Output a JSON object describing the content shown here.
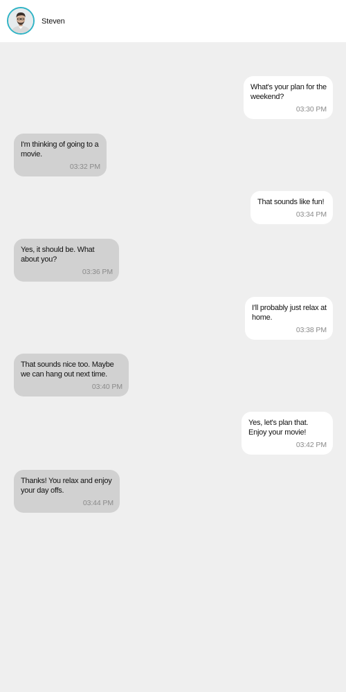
{
  "header": {
    "contact_name": "Steven",
    "avatar_icon": "person-photo-icon",
    "avatar_ring_color": "#2fb3c5"
  },
  "colors": {
    "background": "#efefef",
    "header_background": "#ffffff",
    "sent_bubble": "#ffffff",
    "received_bubble": "#d1d1d1",
    "timestamp": "#8a8a8a"
  },
  "messages": [
    {
      "direction": "sent",
      "text": "What's your plan for the weekend?",
      "time": "03:30 PM"
    },
    {
      "direction": "received",
      "text": "I'm thinking of going to a movie.",
      "time": "03:32 PM"
    },
    {
      "direction": "sent",
      "text": "That sounds like fun!",
      "time": "03:34 PM"
    },
    {
      "direction": "received",
      "text": "Yes, it should be. What about you?",
      "time": "03:36 PM"
    },
    {
      "direction": "sent",
      "text": "I'll probably just relax at home.",
      "time": "03:38 PM"
    },
    {
      "direction": "received",
      "text": "That sounds nice too. Maybe we can hang out next time.",
      "time": "03:40 PM"
    },
    {
      "direction": "sent",
      "text": "Yes, let's plan that. Enjoy your movie!",
      "time": "03:42 PM"
    },
    {
      "direction": "received",
      "text": "Thanks! You relax and enjoy your day offs.",
      "time": "03:44 PM"
    }
  ]
}
